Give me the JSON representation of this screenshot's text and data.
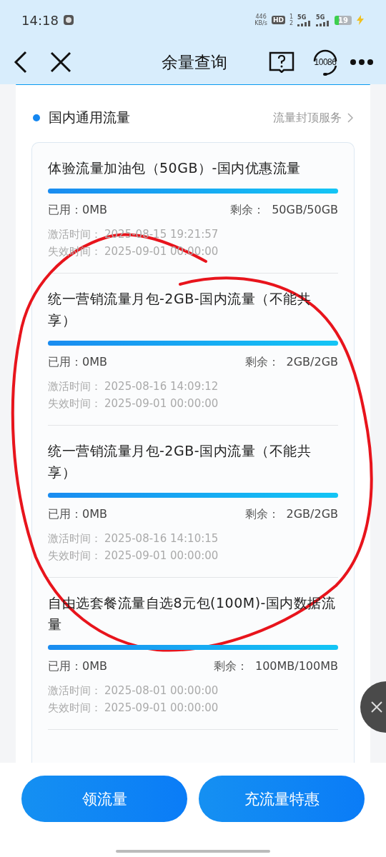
{
  "status_bar": {
    "time": "14:18",
    "speed": "446",
    "speed_unit": "KB/s",
    "hd": "HD",
    "sim_slots": [
      "1",
      "2"
    ],
    "networks": [
      "5G",
      "5G"
    ],
    "battery": "19"
  },
  "header": {
    "title": "余量查询",
    "service_number": "10086"
  },
  "section": {
    "title": "国内通用流量",
    "link": "流量封顶服务"
  },
  "packages": [
    {
      "title": "体验流量加油包（50GB）-国内优惠流量",
      "level": 1,
      "used_label": "已用：",
      "used": "0MB",
      "remain_label": "剩余：",
      "remain": "50GB/50GB",
      "activated_label": "激活时间：",
      "activated": "2025-08-15 19:21:57",
      "expires_label": "失效时间：",
      "expires": "2025-09-01 00:00:00"
    },
    {
      "title": "统一营销流量月包-2GB-国内流量（不能共享）",
      "level": 1,
      "used_label": "已用：",
      "used": "0MB",
      "remain_label": "剩余：",
      "remain": "2GB/2GB",
      "activated_label": "激活时间：",
      "activated": "2025-08-16 14:09:12",
      "expires_label": "失效时间：",
      "expires": "2025-09-01 00:00:00"
    },
    {
      "title": "统一营销流量月包-2GB-国内流量（不能共享）",
      "level": 1,
      "used_label": "已用：",
      "used": "0MB",
      "remain_label": "剩余：",
      "remain": "2GB/2GB",
      "activated_label": "激活时间：",
      "activated": "2025-08-16 14:10:15",
      "expires_label": "失效时间：",
      "expires": "2025-09-01 00:00:00"
    },
    {
      "title": "自由选套餐流量自选8元包(100M)-国内数据流量",
      "level": 1,
      "used_label": "已用：",
      "used": "0MB",
      "remain_label": "剩余：",
      "remain": "100MB/100MB",
      "activated_label": "激活时间：",
      "activated": "2025-08-01 00:00:00",
      "expires_label": "失效时间：",
      "expires": "2025-09-01 00:00:00"
    }
  ],
  "buttons": [
    "领流量",
    "充流量特惠"
  ]
}
